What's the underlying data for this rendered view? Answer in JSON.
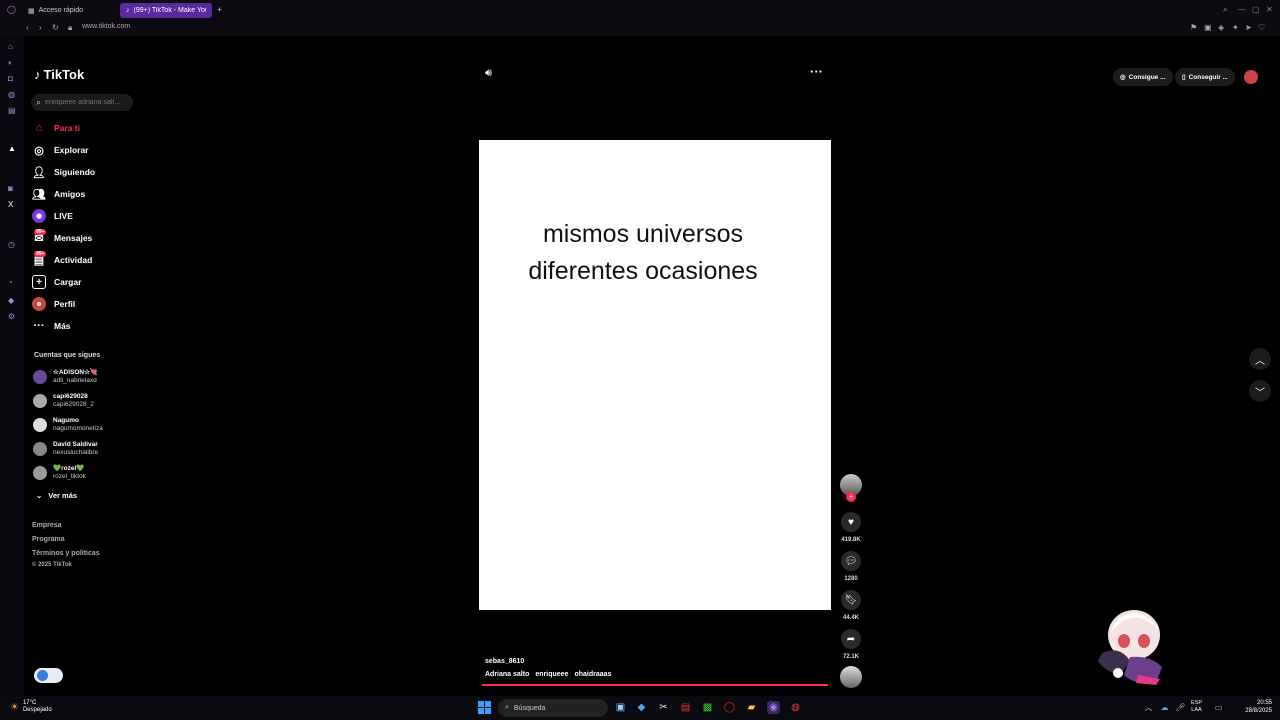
{
  "browser": {
    "tabs": [
      {
        "label": "Acceso rápido"
      },
      {
        "label": "(99+) TikTok - Make Your"
      }
    ],
    "url": "www.tiktok.com"
  },
  "tiktok": {
    "brand": "TikTok",
    "search_placeholder": "enriqueee adriana salt...",
    "nav": [
      {
        "label": "Para ti",
        "icon": "home-icon"
      },
      {
        "label": "Explorar",
        "icon": "compass-icon"
      },
      {
        "label": "Siguiendo",
        "icon": "following-icon"
      },
      {
        "label": "Amigos",
        "icon": "friends-icon"
      },
      {
        "label": "LIVE",
        "icon": "live-icon"
      },
      {
        "label": "Mensajes",
        "icon": "messages-icon",
        "badge": "99+"
      },
      {
        "label": "Actividad",
        "icon": "activity-icon",
        "badge": "99+"
      },
      {
        "label": "Cargar",
        "icon": "upload-icon"
      },
      {
        "label": "Perfil",
        "icon": "profile-icon"
      },
      {
        "label": "Más",
        "icon": "more-icon"
      }
    ],
    "following_title": "Cuentas que sigues",
    "following": [
      {
        "name": "☆ADISON☆💘",
        "user": "adli_nabrielaxd"
      },
      {
        "name": "capi629028",
        "user": "capi629028_2"
      },
      {
        "name": "Nagumo",
        "user": "nagumomonetiza"
      },
      {
        "name": "David Saldivar",
        "user": "nexusluchalibre"
      },
      {
        "name": "💚rozel💚",
        "user": "rozel_tiktok"
      }
    ],
    "see_more": "Ver más",
    "footer": [
      "Empresa",
      "Programa",
      "Términos y políticas",
      "© 2025 TikTok"
    ],
    "top_buttons": [
      "Consigue ...",
      "Conseguir ..."
    ]
  },
  "video": {
    "caption_line1": "mismos universos",
    "caption_line2": "diferentes ocasiones",
    "author": "sebas_8610",
    "tags": [
      "Adriana salto",
      "enriqueee",
      "ohaidraaas"
    ],
    "progress": 1.0,
    "actions": {
      "likes": "419.8K",
      "comments": "1280",
      "saves": "44.4K",
      "shares": "72.1K"
    }
  },
  "taskbar": {
    "weather_temp": "17°C",
    "weather_desc": "Despejado",
    "search_label": "Búsqueda",
    "lang_top": "ESP",
    "lang_bottom": "LAA",
    "time": "20:55",
    "date": "28/8/2025"
  },
  "colors": {
    "accent": "#fe2c55",
    "opera_purple": "#5b2a9e"
  }
}
